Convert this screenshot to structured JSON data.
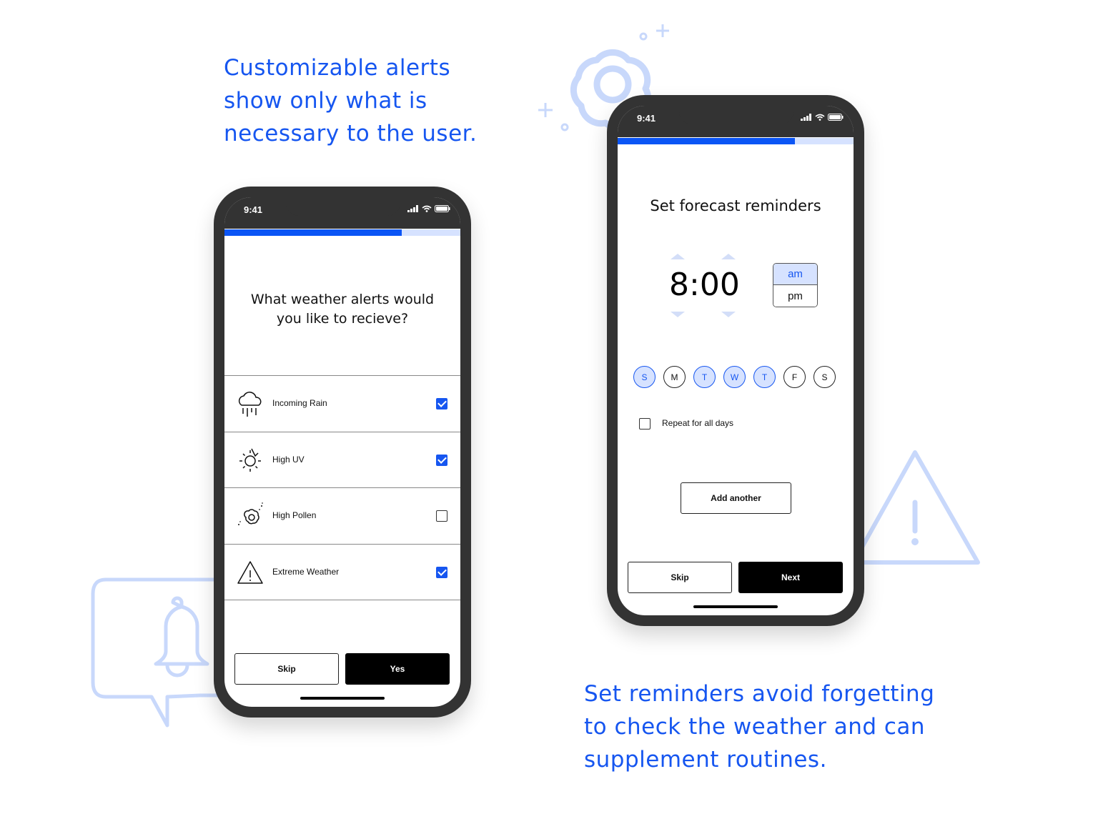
{
  "captions": {
    "alerts": [
      "Customizable alerts",
      "show only what is",
      "necessary to the user."
    ],
    "reminders": [
      "Set reminders avoid forgetting",
      "to check the weather and can",
      "supplement routines."
    ]
  },
  "colors": {
    "accent": "#1656f0",
    "accent_light": "#d6e2ff",
    "phone_frame": "#333333",
    "decoration": "#c8d8fb"
  },
  "decorations": [
    "bell-speech-bubble-icon",
    "flower-icon",
    "warning-triangle-icon"
  ],
  "alerts_screen": {
    "status_time": "9:41",
    "progress": 0.75,
    "question": [
      "What weather alerts would",
      "you like to recieve?"
    ],
    "alerts": [
      {
        "label": "Incoming Rain",
        "icon": "rain-cloud-icon",
        "checked": true
      },
      {
        "label": "High UV",
        "icon": "sun-uv-icon",
        "checked": true
      },
      {
        "label": "High Pollen",
        "icon": "pollen-flower-icon",
        "checked": false
      },
      {
        "label": "Extreme Weather",
        "icon": "warning-icon",
        "checked": true
      }
    ],
    "skip_label": "Skip",
    "primary_label": "Yes"
  },
  "reminder_screen": {
    "status_time": "9:41",
    "progress": 0.75,
    "title": "Set forecast reminders",
    "time": "8:00",
    "am_label": "am",
    "pm_label": "pm",
    "selected_period": "am",
    "days": [
      {
        "label": "S",
        "selected": true
      },
      {
        "label": "M",
        "selected": false
      },
      {
        "label": "T",
        "selected": true
      },
      {
        "label": "W",
        "selected": true
      },
      {
        "label": "T",
        "selected": true
      },
      {
        "label": "F",
        "selected": false
      },
      {
        "label": "S",
        "selected": false
      }
    ],
    "repeat_label": "Repeat for all days",
    "repeat_checked": false,
    "add_another_label": "Add another",
    "skip_label": "Skip",
    "next_label": "Next"
  }
}
